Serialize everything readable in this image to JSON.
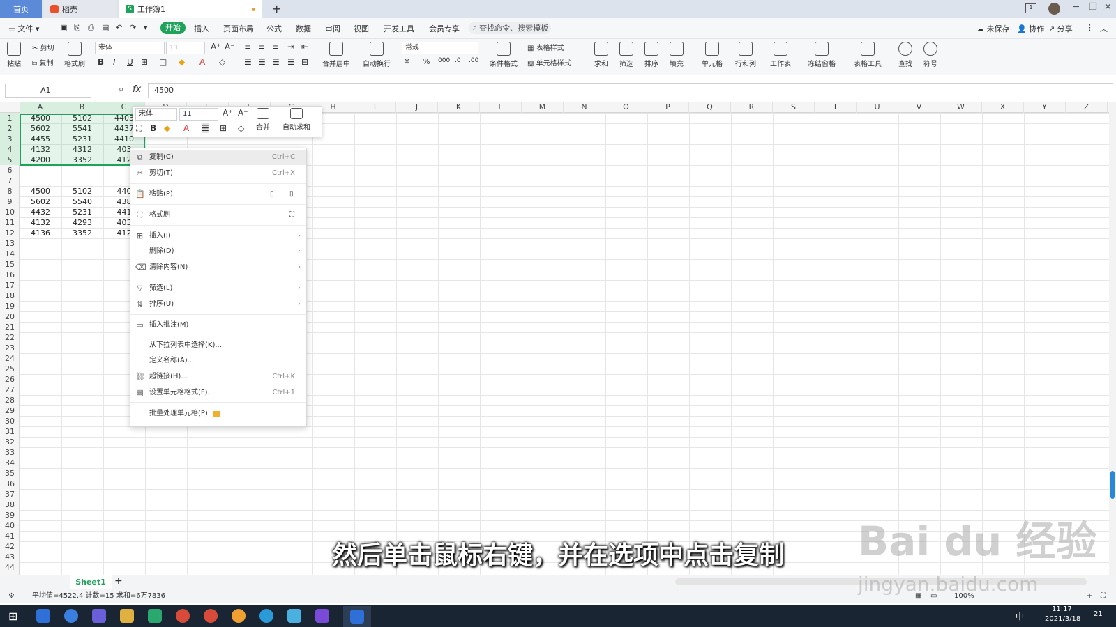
{
  "tabs": [
    {
      "label": "首页"
    },
    {
      "label": "稻壳"
    },
    {
      "label": "工作簿1"
    }
  ],
  "menu": {
    "file": "文件",
    "items": [
      "开始",
      "插入",
      "页面布局",
      "公式",
      "数据",
      "审阅",
      "视图",
      "开发工具",
      "会员专享"
    ],
    "search_placeholder": "查找命令、搜索模板",
    "unsaved": "未保存",
    "collab": "协作",
    "share": "分享"
  },
  "ribbon": {
    "paste": "粘贴",
    "cut": "剪切",
    "copy": "复制",
    "format_painter": "格式刷",
    "font_name": "宋体",
    "font_size": "11",
    "merge_center": "合并居中",
    "wrap": "自动换行",
    "num_format": "常规",
    "cond_format": "条件格式",
    "table_style": "表格样式",
    "cell_style": "单元格样式",
    "sum": "求和",
    "filter": "筛选",
    "sort": "排序",
    "fill": "填充",
    "cell": "单元格",
    "rowcol": "行和列",
    "worksheet": "工作表",
    "freeze": "冻结窗格",
    "table_tools": "表格工具",
    "find": "查找",
    "symbol": "符号"
  },
  "formula": {
    "name_box": "A1",
    "fx": "fx",
    "value": "4500"
  },
  "columns": [
    "A",
    "B",
    "C",
    "D",
    "E",
    "F",
    "G",
    "H",
    "I",
    "J",
    "K",
    "L",
    "M",
    "N",
    "O",
    "P",
    "Q",
    "R",
    "S",
    "T",
    "U",
    "V",
    "W",
    "X",
    "Y",
    "Z"
  ],
  "rows": [
    "1",
    "2",
    "3",
    "4",
    "5",
    "6",
    "7",
    "8",
    "9",
    "10",
    "11",
    "12",
    "13",
    "14",
    "15",
    "16",
    "17",
    "18",
    "19",
    "20",
    "21",
    "22",
    "23",
    "24",
    "25",
    "26",
    "27",
    "28",
    "29",
    "30",
    "31",
    "32",
    "33",
    "34",
    "35",
    "36",
    "37",
    "38",
    "39",
    "40",
    "41",
    "42",
    "43",
    "44"
  ],
  "cells": [
    {
      "r": 0,
      "c": 0,
      "v": "4500"
    },
    {
      "r": 0,
      "c": 1,
      "v": "5102"
    },
    {
      "r": 0,
      "c": 2,
      "v": "4403"
    },
    {
      "r": 1,
      "c": 0,
      "v": "5602"
    },
    {
      "r": 1,
      "c": 1,
      "v": "5541"
    },
    {
      "r": 1,
      "c": 2,
      "v": "4437"
    },
    {
      "r": 2,
      "c": 0,
      "v": "4455"
    },
    {
      "r": 2,
      "c": 1,
      "v": "5231"
    },
    {
      "r": 2,
      "c": 2,
      "v": "4410"
    },
    {
      "r": 3,
      "c": 0,
      "v": "4132"
    },
    {
      "r": 3,
      "c": 1,
      "v": "4312"
    },
    {
      "r": 3,
      "c": 2,
      "v": "403"
    },
    {
      "r": 4,
      "c": 0,
      "v": "4200"
    },
    {
      "r": 4,
      "c": 1,
      "v": "3352"
    },
    {
      "r": 4,
      "c": 2,
      "v": "412"
    },
    {
      "r": 7,
      "c": 0,
      "v": "4500"
    },
    {
      "r": 7,
      "c": 1,
      "v": "5102"
    },
    {
      "r": 7,
      "c": 2,
      "v": "440"
    },
    {
      "r": 8,
      "c": 0,
      "v": "5602"
    },
    {
      "r": 8,
      "c": 1,
      "v": "5540"
    },
    {
      "r": 8,
      "c": 2,
      "v": "438"
    },
    {
      "r": 9,
      "c": 0,
      "v": "4432"
    },
    {
      "r": 9,
      "c": 1,
      "v": "5231"
    },
    {
      "r": 9,
      "c": 2,
      "v": "441"
    },
    {
      "r": 10,
      "c": 0,
      "v": "4132"
    },
    {
      "r": 10,
      "c": 1,
      "v": "4293"
    },
    {
      "r": 10,
      "c": 2,
      "v": "403"
    },
    {
      "r": 11,
      "c": 0,
      "v": "4136"
    },
    {
      "r": 11,
      "c": 1,
      "v": "3352"
    },
    {
      "r": 11,
      "c": 2,
      "v": "412"
    }
  ],
  "mini_toolbar": {
    "font": "宋体",
    "size": "11",
    "merge": "合并",
    "autosum": "自动求和"
  },
  "context_menu": [
    {
      "label": "复制(C)",
      "shortcut": "Ctrl+C",
      "icon": "copy-icon"
    },
    {
      "label": "剪切(T)",
      "shortcut": "Ctrl+X",
      "icon": "cut-icon"
    },
    {
      "label": "粘贴(P)",
      "shortcut": "",
      "icon": "paste-icon"
    },
    {
      "label": "格式刷",
      "shortcut": "",
      "icon": "format-painter-icon"
    },
    {
      "label": "插入(I)",
      "shortcut": "",
      "icon": "insert-icon",
      "submenu": true
    },
    {
      "label": "删除(D)",
      "shortcut": "",
      "icon": "",
      "submenu": true
    },
    {
      "label": "清除内容(N)",
      "shortcut": "",
      "icon": "eraser-icon",
      "submenu": true
    },
    {
      "label": "筛选(L)",
      "shortcut": "",
      "icon": "filter-icon",
      "submenu": true
    },
    {
      "label": "排序(U)",
      "shortcut": "",
      "icon": "sort-icon",
      "submenu": true
    },
    {
      "label": "插入批注(M)",
      "shortcut": "",
      "icon": "comment-icon"
    },
    {
      "label": "从下拉列表中选择(K)...",
      "shortcut": "",
      "icon": ""
    },
    {
      "label": "定义名称(A)...",
      "shortcut": "",
      "icon": ""
    },
    {
      "label": "超链接(H)...",
      "shortcut": "Ctrl+K",
      "icon": "link-icon"
    },
    {
      "label": "设置单元格格式(F)...",
      "shortcut": "Ctrl+1",
      "icon": "format-cells-icon"
    },
    {
      "label": "批量处理单元格(P)",
      "shortcut": "",
      "icon": "crown-icon"
    }
  ],
  "sheet": {
    "name": "Sheet1"
  },
  "status": {
    "text": "平均值=4522.4  计数=15  求和=6万7836",
    "zoom": "100%"
  },
  "taskbar": {
    "time": "11:17",
    "date": "2021/3/18",
    "ime": "中",
    "notif": "21"
  },
  "caption": "然后单击鼠标右键，并在选项中点击复制",
  "watermark": {
    "main": "Bai du 经验",
    "sub": "jingyan.baidu.com"
  },
  "colors": {
    "accent": "#1fa35a",
    "home_tab": "#5b8ad8"
  }
}
